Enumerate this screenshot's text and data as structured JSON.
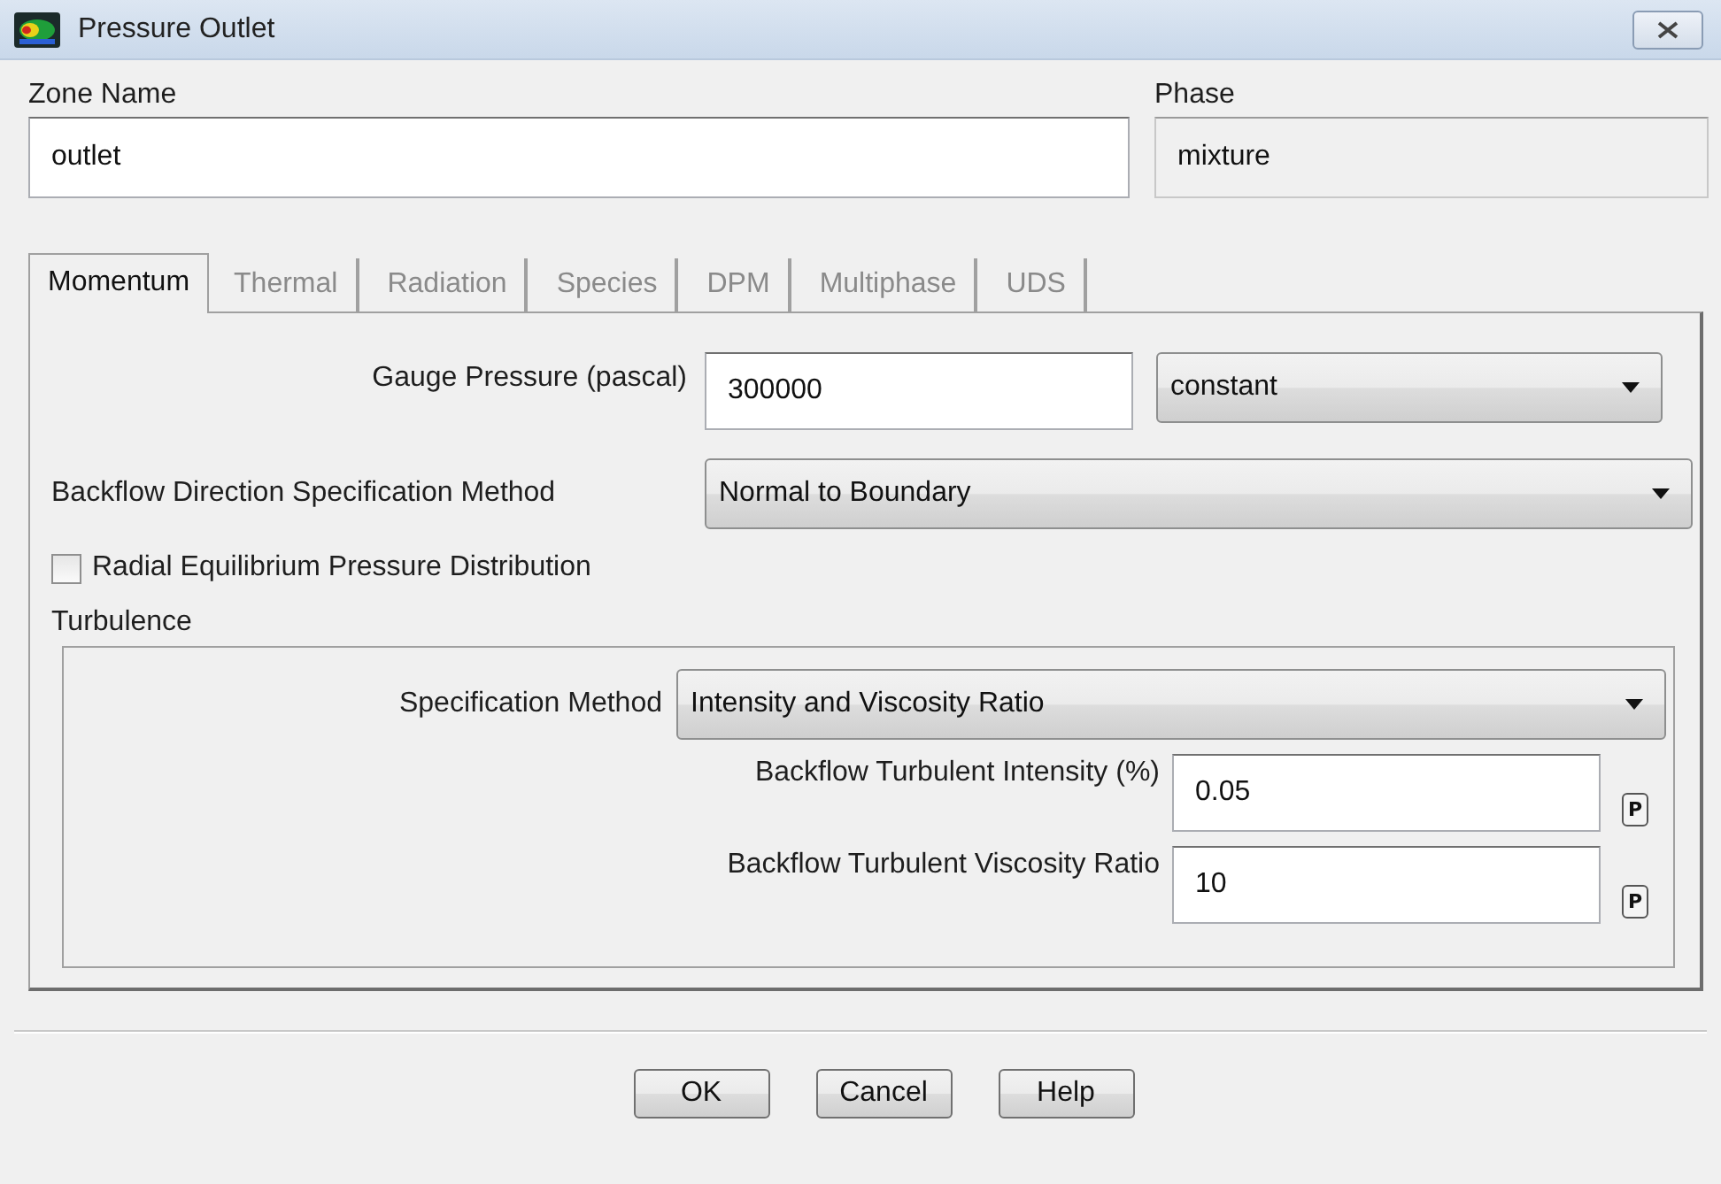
{
  "window": {
    "title": "Pressure Outlet"
  },
  "zone_name": {
    "label": "Zone Name",
    "value": "outlet"
  },
  "phase": {
    "label": "Phase",
    "value": "mixture",
    "disabled": true
  },
  "tabs": [
    {
      "label": "Momentum",
      "selected": true
    },
    {
      "label": "Thermal",
      "selected": false
    },
    {
      "label": "Radiation",
      "selected": false
    },
    {
      "label": "Species",
      "selected": false
    },
    {
      "label": "DPM",
      "selected": false
    },
    {
      "label": "Multiphase",
      "selected": false
    },
    {
      "label": "UDS",
      "selected": false
    }
  ],
  "momentum": {
    "gauge_pressure": {
      "label": "Gauge Pressure (pascal)",
      "value": "300000",
      "method": "constant"
    },
    "backflow_direction": {
      "label": "Backflow Direction Specification Method",
      "value": "Normal to Boundary"
    },
    "radial_equilibrium": {
      "label": "Radial Equilibrium Pressure Distribution",
      "checked": false
    },
    "turbulence": {
      "title": "Turbulence",
      "specification_method": {
        "label": "Specification Method",
        "value": "Intensity and Viscosity Ratio"
      },
      "params": [
        {
          "label": "Backflow Turbulent Intensity (%)",
          "value": "0.05",
          "param_button": "P"
        },
        {
          "label": "Backflow Turbulent Viscosity Ratio",
          "value": "10",
          "param_button": "P"
        }
      ]
    }
  },
  "buttons": [
    "OK",
    "Cancel",
    "Help"
  ]
}
